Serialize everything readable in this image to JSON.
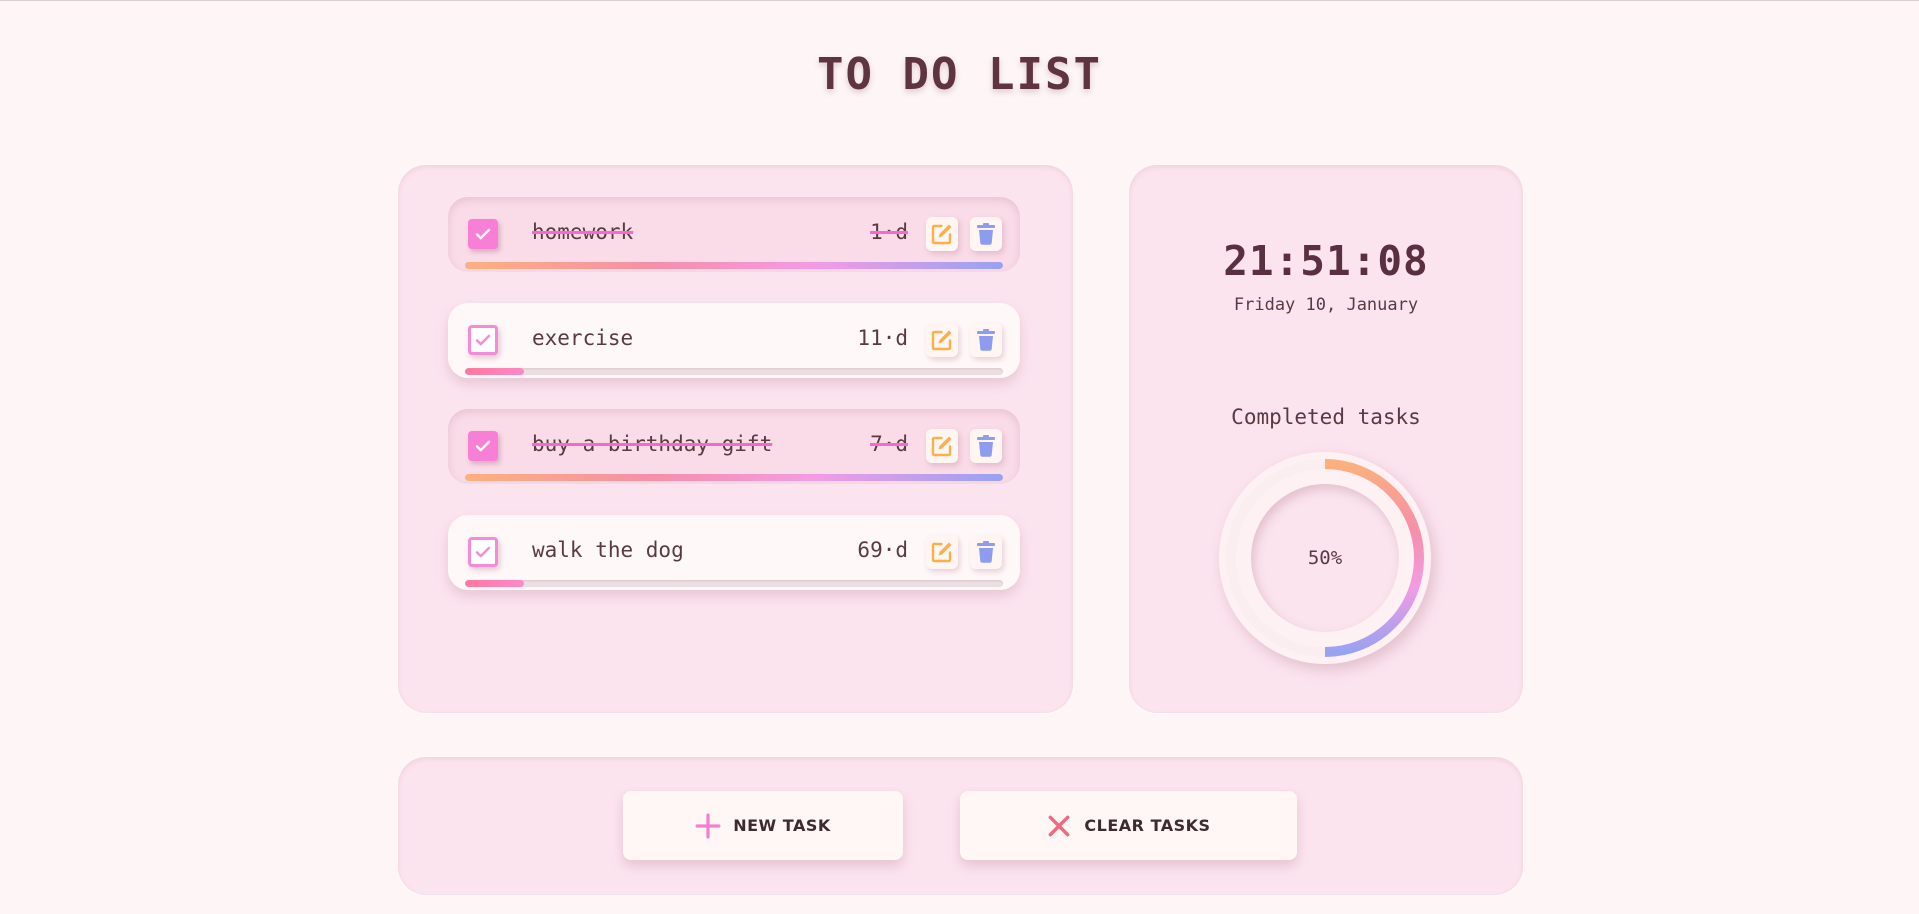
{
  "page": {
    "title": "TO DO LIST"
  },
  "tasks": [
    {
      "name": "homework",
      "days": "1·d",
      "completed": true,
      "progress": 1.0
    },
    {
      "name": "exercise",
      "days": "11·d",
      "completed": false,
      "progress": 0.11
    },
    {
      "name": "buy a birthday gift",
      "days": "7·d",
      "completed": true,
      "progress": 1.0
    },
    {
      "name": "walk the dog",
      "days": "69·d",
      "completed": false,
      "progress": 0.11
    }
  ],
  "stats": {
    "time": "21:51:08",
    "date": "Friday 10, January",
    "completed_label": "Completed tasks",
    "completed_percent": "50%",
    "completed_fraction": 0.5
  },
  "actions": {
    "new_task_label": "NEW TASK",
    "clear_tasks_label": "CLEAR TASKS"
  },
  "icons": {
    "check": "check-icon",
    "edit": "edit-icon",
    "delete": "trash-icon",
    "add": "plus-icon",
    "clear": "x-icon"
  },
  "colors": {
    "background": "#fdf5f6",
    "panel": "#fce4ef",
    "checkbox": "#f77fd6",
    "edit": "#fbb04a",
    "delete": "#8e9cf0",
    "clear": "#f06a7e",
    "add": "#f37fd0"
  }
}
